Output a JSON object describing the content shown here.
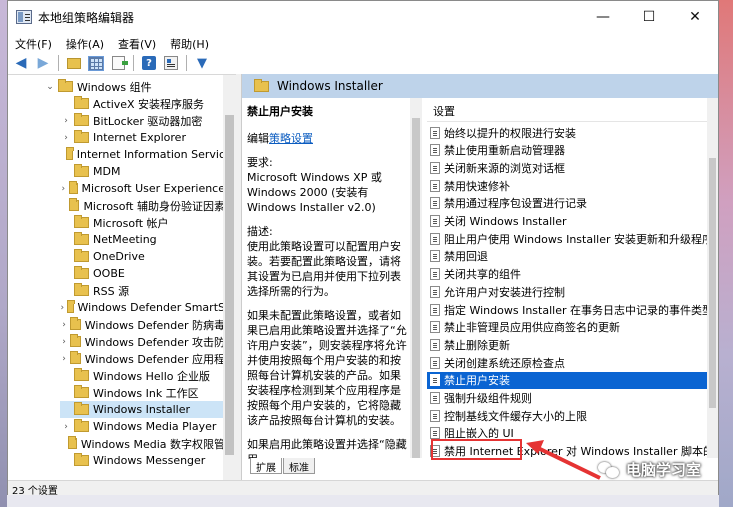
{
  "window": {
    "title": "本地组策略编辑器",
    "minimize": "—",
    "maximize": "☐",
    "close": "✕"
  },
  "menu": [
    "文件(F)",
    "操作(A)",
    "查看(V)",
    "帮助(H)"
  ],
  "tree": {
    "parent": "Windows 组件",
    "items": [
      {
        "label": "ActiveX 安装程序服务",
        "expandable": false
      },
      {
        "label": "BitLocker 驱动器加密",
        "expandable": true
      },
      {
        "label": "Internet Explorer",
        "expandable": true
      },
      {
        "label": "Internet Information Servic",
        "expandable": false
      },
      {
        "label": "MDM",
        "expandable": false
      },
      {
        "label": "Microsoft User Experience",
        "expandable": true
      },
      {
        "label": "Microsoft 辅助身份验证因素",
        "expandable": false
      },
      {
        "label": "Microsoft 帐户",
        "expandable": false
      },
      {
        "label": "NetMeeting",
        "expandable": false
      },
      {
        "label": "OneDrive",
        "expandable": false
      },
      {
        "label": "OOBE",
        "expandable": false
      },
      {
        "label": "RSS 源",
        "expandable": false
      },
      {
        "label": "Windows Defender SmartS",
        "expandable": true
      },
      {
        "label": "Windows Defender 防病毒",
        "expandable": true
      },
      {
        "label": "Windows Defender 攻击防",
        "expandable": true
      },
      {
        "label": "Windows Defender 应用程",
        "expandable": true
      },
      {
        "label": "Windows Hello 企业版",
        "expandable": false
      },
      {
        "label": "Windows Ink 工作区",
        "expandable": false
      },
      {
        "label": "Windows Installer",
        "expandable": false,
        "selected": true
      },
      {
        "label": "Windows Media Player",
        "expandable": true
      },
      {
        "label": "Windows Media 数字权限管",
        "expandable": false
      },
      {
        "label": "Windows Messenger",
        "expandable": false
      }
    ]
  },
  "pane_header": "Windows Installer",
  "description": {
    "title": "禁止用户安装",
    "edit_prefix": "编辑",
    "edit_link": "策略设置",
    "requirements_label": "要求:",
    "requirements": "Microsoft Windows XP 或 Windows 2000 (安装有 Windows Installer v2.0)",
    "desc_label": "描述:",
    "desc": "使用此策略设置可以配置用户安装。若要配置此策略设置，请将其设置为已启用并使用下拉列表选择所需的行为。",
    "para2": "如果未配置此策略设置，或者如果已启用此策略设置并选择了“允许用户安装”，则安装程序将允许并使用按照每个用户安装的和按照每台计算机安装的产品。如果安装程序检测到某个应用程序是按照每个用户安装的，它将隐藏该产品按照每台计算机的安装。",
    "para3": "如果启用此策略设置并选择“隐藏用"
  },
  "settings": {
    "header": "设置",
    "items": [
      "始终以提升的权限进行安装",
      "禁止使用重新启动管理器",
      "关闭新来源的浏览对话框",
      "禁用快速修补",
      "禁用通过程序包设置进行记录",
      "关闭 Windows Installer",
      "阻止用户使用 Windows Installer 安装更新和升级程序",
      "禁用回退",
      "关闭共享的组件",
      "允许用户对安装进行控制",
      "指定 Windows Installer 在事务日志中记录的事件类型。",
      "禁止非管理员应用供应商签名的更新",
      "禁止删除更新",
      "关闭创建系统还原检查点",
      "禁止用户安装",
      "强制升级组件规则",
      "控制基线文件缓存大小的上限",
      "阻止嵌入的 UI",
      "禁用 Internet Explorer 对 Windows Installer 脚本的安全"
    ],
    "selected_index": 14
  },
  "tabs": [
    "扩展",
    "标准"
  ],
  "status": "23 个设置",
  "watermark": "电脑学习室"
}
